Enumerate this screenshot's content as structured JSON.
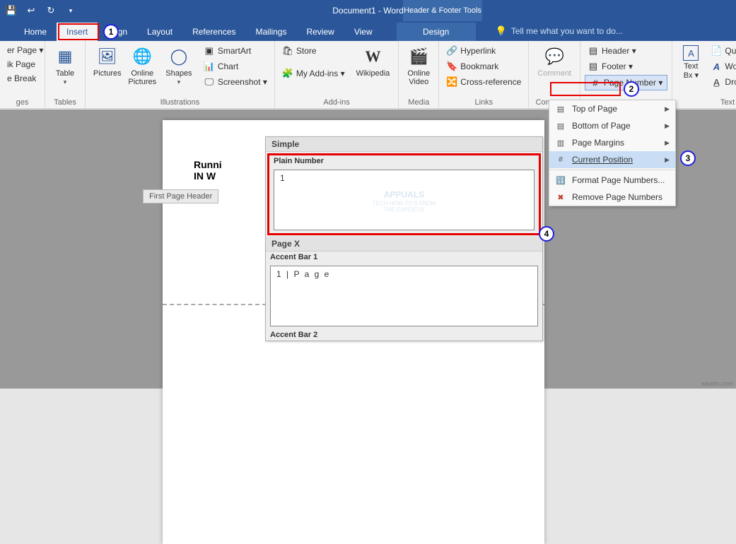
{
  "title": "Document1 - Word",
  "toolTab": "Header & Footer Tools",
  "tabs": {
    "home": "Home",
    "insert": "Insert",
    "design_hidden": "sign",
    "layout": "Layout",
    "references": "References",
    "mailings": "Mailings",
    "review": "Review",
    "view": "View",
    "designTool": "Design"
  },
  "tellMe": "Tell me what you want to do...",
  "ribbon": {
    "pages": {
      "cover": "er Page ▾",
      "blank": "ik Page",
      "break": "e Break",
      "label": "ges"
    },
    "tables": {
      "table": "Table",
      "label": "Tables"
    },
    "illustrations": {
      "pictures": "Pictures",
      "online_pictures": "Online\nPictures",
      "shapes": "Shapes",
      "smartart": "SmartArt",
      "chart": "Chart",
      "screenshot": "Screenshot ▾",
      "label": "Illustrations"
    },
    "addins": {
      "store": "Store",
      "myaddins": "My Add-ins ▾",
      "wikipedia": "Wikipedia",
      "label": "Add-ins"
    },
    "media": {
      "online_video": "Online\nVideo",
      "label": "Media"
    },
    "links": {
      "hyperlink": "Hyperlink",
      "bookmark": "Bookmark",
      "crossref": "Cross-reference",
      "label": "Links"
    },
    "comments": {
      "comment": "Comment",
      "label": "Comments"
    },
    "headerfooter": {
      "header": "Header ▾",
      "footer": "Footer ▾",
      "pagenum": "Page Number ▾"
    },
    "text": {
      "textbox": "Text\nBx ▾",
      "quickparts": "Quick Parts ▾",
      "wordart": "WordArt ▾",
      "dropcap": "Drop Cap ▾",
      "label": "Text"
    }
  },
  "menu": {
    "top": "Top of Page",
    "bottom": "Bottom of Page",
    "margins": "Page Margins",
    "current": "Current Position",
    "format": "Format Page Numbers...",
    "remove": "Remove Page Numbers"
  },
  "gallery": {
    "section": "Simple",
    "item1": "Plain Number",
    "preview1": "1",
    "divider1": "Page X",
    "item2": "Accent Bar 1",
    "preview2": "1 | P a g e",
    "item3": "Accent Bar 2"
  },
  "doc": {
    "line1": "Runni",
    "line2": "IN W",
    "headerTag": "First Page Header"
  },
  "watermark": {
    "brand": "APPUALS",
    "tag": "TECH HOW-TO'S FROM\nTHE EXPERTS!"
  },
  "annotations": {
    "n1": "1",
    "n2": "2",
    "n3": "3",
    "n4": "4"
  },
  "site": "wsxdn.com"
}
